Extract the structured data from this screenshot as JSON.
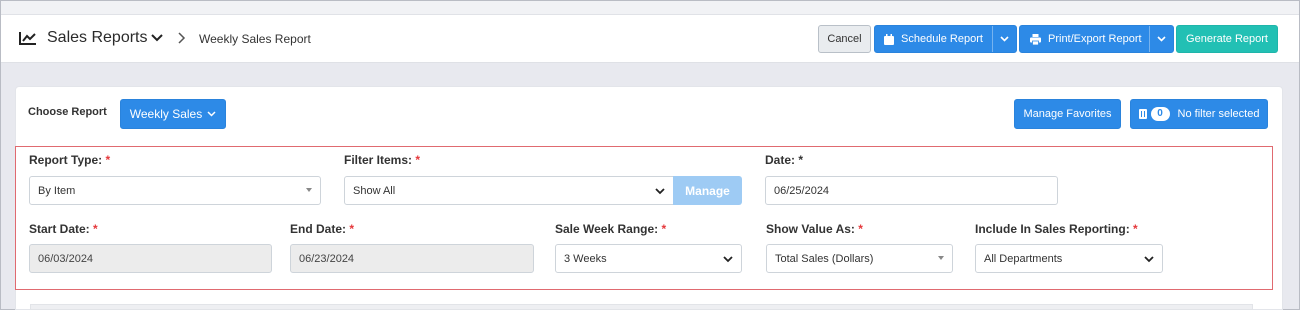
{
  "header": {
    "title": "Sales Reports",
    "breadcrumb": "Weekly Sales Report",
    "icon": "chart-line-icon"
  },
  "actions": {
    "cancel": "Cancel",
    "schedule": "Schedule Report",
    "print_export": "Print/Export Report",
    "generate": "Generate Report"
  },
  "report_bar": {
    "choose_label": "Choose Report",
    "selected_report": "Weekly Sales",
    "manage_favorites": "Manage Favorites",
    "filter_count": "0",
    "filter_status": "No filter selected"
  },
  "form": {
    "report_type": {
      "label": "Report Type:",
      "value": "By Item"
    },
    "filter_items": {
      "label": "Filter Items:",
      "value": "Show All",
      "manage": "Manage"
    },
    "date": {
      "label": "Date:",
      "value": "06/25/2024"
    },
    "start_date": {
      "label": "Start Date:",
      "value": "06/03/2024"
    },
    "end_date": {
      "label": "End Date:",
      "value": "06/23/2024"
    },
    "sale_week_range": {
      "label": "Sale Week Range:",
      "value": "3 Weeks"
    },
    "show_value_as": {
      "label": "Show Value As:",
      "value": "Total Sales (Dollars)"
    },
    "include_in_sales": {
      "label": "Include In Sales Reporting:",
      "value": "All Departments"
    },
    "required_mark": "*"
  },
  "colors": {
    "primary": "#2d8ae7",
    "teal": "#22c0b4",
    "required": "#e5383b",
    "highlight_border": "#e06a70"
  }
}
